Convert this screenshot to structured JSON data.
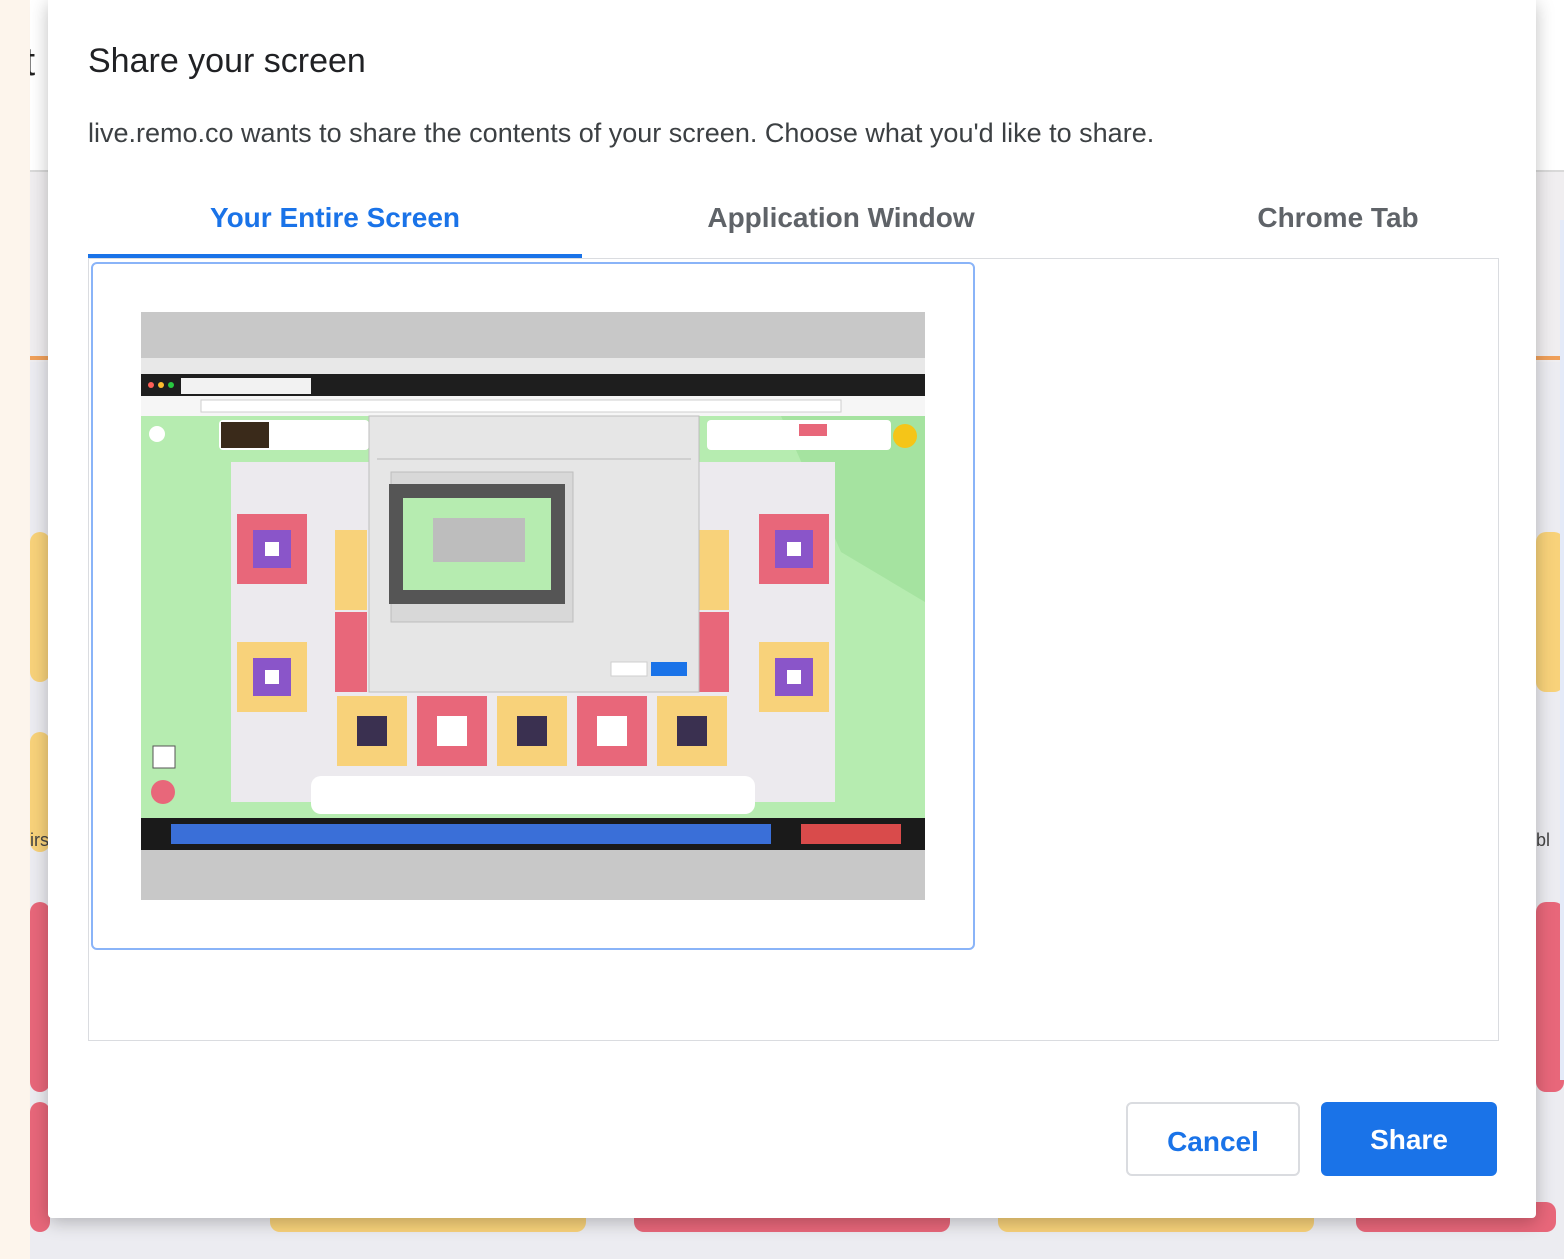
{
  "dialog": {
    "title": "Share your screen",
    "description": "live.remo.co wants to share the contents of your screen. Choose what you'd like to share.",
    "tabs": [
      {
        "label": "Your Entire Screen",
        "active": true
      },
      {
        "label": "Application Window",
        "active": false
      },
      {
        "label": "Chrome Tab",
        "active": false
      }
    ],
    "buttons": {
      "cancel": "Cancel",
      "share": "Share"
    }
  },
  "background": {
    "left_letter": "t",
    "left_side_text": "irs",
    "right_side_text": "bl"
  },
  "colors": {
    "accent_blue": "#1a73e8",
    "tile_border": "#8ab4f8",
    "table_pink": "#e8677a",
    "table_yellow": "#f8d27a",
    "floor_green": "#b6ecb0"
  }
}
